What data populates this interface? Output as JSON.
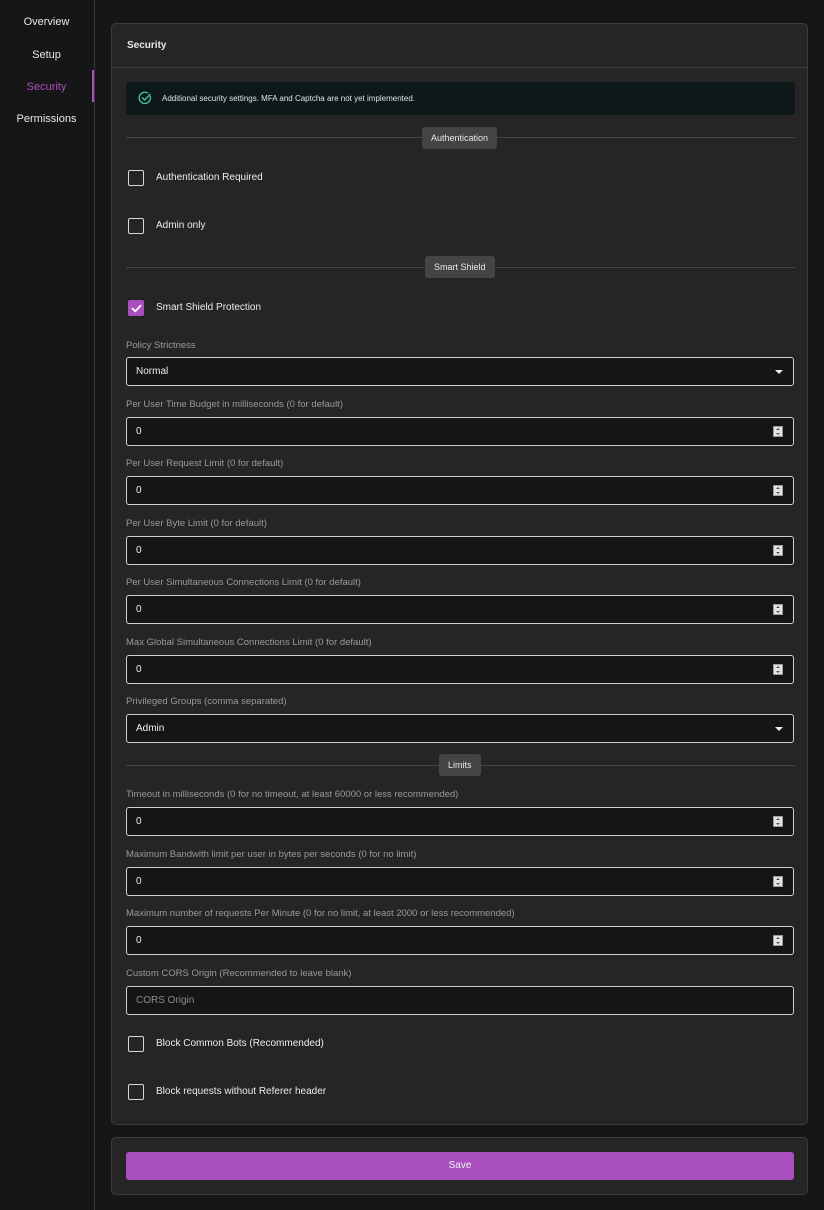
{
  "sidebar": {
    "items": [
      {
        "label": "Overview"
      },
      {
        "label": "Setup"
      },
      {
        "label": "Security",
        "active": true
      },
      {
        "label": "Permissions"
      }
    ]
  },
  "panel": {
    "title": "Security",
    "alert": {
      "text": "Additional security settings. MFA and Captcha are not yet implemented.",
      "icon": "check-circle-icon"
    }
  },
  "sections": {
    "authentication": "Authentication",
    "smart_shield": "Smart Shield",
    "limits": "Limits"
  },
  "checkboxes": {
    "auth_required": {
      "label": "Authentication Required",
      "checked": false
    },
    "admin_only": {
      "label": "Admin only",
      "checked": false
    },
    "smart_shield": {
      "label": "Smart Shield Protection",
      "checked": true
    },
    "block_bots": {
      "label": "Block Common Bots (Recommended)",
      "checked": false
    },
    "block_referer": {
      "label": "Block requests without Referer header",
      "checked": false
    }
  },
  "fields": {
    "policy_strictness": {
      "label": "Policy Strictness",
      "value": "Normal"
    },
    "time_budget": {
      "label": "Per User Time Budget in milliseconds (0 for default)",
      "value": "0"
    },
    "request_limit": {
      "label": "Per User Request Limit (0 for default)",
      "value": "0"
    },
    "byte_limit": {
      "label": "Per User Byte Limit (0 for default)",
      "value": "0"
    },
    "sim_conn": {
      "label": "Per User Simultaneous Connections Limit (0 for default)",
      "value": "0"
    },
    "global_sim_conn": {
      "label": "Max Global Simultaneous Connections Limit (0 for default)",
      "value": "0"
    },
    "privileged_groups": {
      "label": "Privileged Groups (comma separated)",
      "value": "Admin"
    },
    "timeout": {
      "label": "Timeout in milliseconds (0 for no timeout, at least 60000 or less recommended)",
      "value": "0"
    },
    "bandwidth": {
      "label": "Maximum Bandwith limit per user in bytes per seconds (0 for no limit)",
      "value": "0"
    },
    "requests_per_minute": {
      "label": "Maximum number of requests Per Minute (0 for no limit, at least 2000 or less recommended)",
      "value": "0"
    },
    "cors_origin": {
      "label": "Custom CORS Origin (Recommended to leave blank)",
      "placeholder": "CORS Origin"
    }
  },
  "actions": {
    "save": "Save"
  },
  "colors": {
    "accent": "#a94fc0",
    "background": "#161616",
    "panel": "#252525"
  }
}
